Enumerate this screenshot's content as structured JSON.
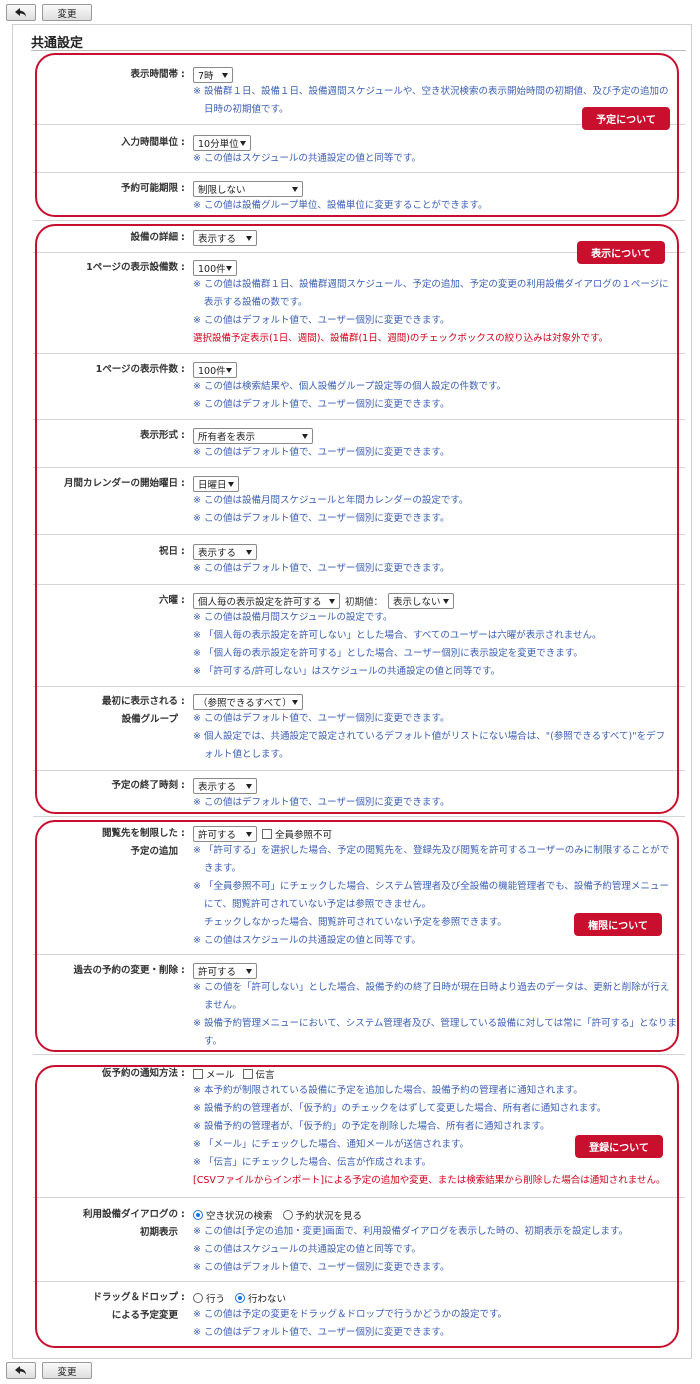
{
  "toolbar": {
    "back_label": "",
    "change_label": "変更"
  },
  "section_title": "共通設定",
  "rows": {
    "display_time_zone": {
      "label": "表示時間帯",
      "value": "7時",
      "notes": [
        "※ 設備群１日、設備１日、設備週間スケジュールや、空き状況検索の表示開始時間の初期値、及び予定の追加の",
        "日時の初期値です。"
      ]
    },
    "input_time_unit": {
      "label": "入力時間単位",
      "value": "10分単位",
      "notes": [
        "※ この値はスケジュールの共通設定の値と同等です。"
      ]
    },
    "reservation_limit": {
      "label": "予約可能期限",
      "value": "制限しない",
      "notes": [
        "※ この値は設備グループ単位、設備単位に変更することができます。"
      ]
    },
    "equipment_details": {
      "label": "設備の詳細",
      "value": "表示する"
    },
    "equipment_per_page": {
      "label": "1ページの表示設備数",
      "value": "100件",
      "notes": [
        "※ この値は設備群１日、設備群週間スケジュール、予定の追加、予定の変更の利用設備ダイアログの１ページに",
        "表示する設備の数です。",
        "※ この値はデフォルト値で、ユーザー個別に変更できます。"
      ],
      "warning": "選択設備予定表示(1日、週間)、設備群(1日、週間)のチェックボックスの絞り込みは対象外です。"
    },
    "items_per_page": {
      "label": "1ページの表示件数",
      "value": "100件",
      "notes": [
        "※ この値は検索結果や、個人設備グループ設定等の個人設定の件数です。",
        "※ この値はデフォルト値で、ユーザー個別に変更できます。"
      ]
    },
    "display_format": {
      "label": "表示形式",
      "value": "所有者を表示",
      "notes": [
        "※ この値はデフォルト値で、ユーザー個別に変更できます。"
      ]
    },
    "calendar_start_day": {
      "label": "月間カレンダーの開始曜日",
      "value": "日曜日",
      "notes": [
        "※ この値は設備月間スケジュールと年間カレンダーの設定です。",
        "※ この値はデフォルト値で、ユーザー個別に変更できます。"
      ]
    },
    "holidays": {
      "label": "祝日",
      "value": "表示する",
      "notes": [
        "※ この値はデフォルト値で、ユーザー個別に変更できます。"
      ]
    },
    "rokuyo": {
      "label": "六曜",
      "value": "個人毎の表示設定を許可する",
      "initial_label": "初期値：",
      "initial_value": "表示しない",
      "notes": [
        "※ この値は設備月間スケジュールの設定です。",
        "※ 「個人毎の表示設定を許可しない」とした場合、すべてのユーザーは六曜が表示されません。",
        "※ 「個人毎の表示設定を許可する」とした場合、ユーザー個別に表示設定を変更できます。",
        "※ 「許可する/許可しない」はスケジュールの共通設定の値と同等です。"
      ]
    },
    "first_group": {
      "label_line1": "最初に表示される",
      "label_line2": "設備グループ",
      "value": "（参照できるすべて）",
      "notes": [
        "※ この値はデフォルト値で、ユーザー個別に変更できます。",
        "※ 個人設定では、共通設定で設定されているデフォルト値がリストにない場合は、\"(参照できるすべて)\"をデフ",
        "ォルト値とします。"
      ]
    },
    "end_time": {
      "label": "予定の終了時刻",
      "value": "表示する",
      "notes": [
        "※ この値はデフォルト値で、ユーザー個別に変更できます。"
      ]
    },
    "restricted_viewers": {
      "label_line1": "閲覧先を制限した",
      "label_line2": "予定の追加",
      "value": "許可する",
      "checkbox_label": "全員参照不可",
      "notes": [
        "※ 「許可する」を選択した場合、予定の閲覧先を、登録先及び閲覧を許可するユーザーのみに制限することがで",
        "きます。",
        "※ 「全員参照不可」にチェックした場合、システム管理者及び全設備の機能管理者でも、設備予約管理メニュー",
        "にて、閲覧許可されていない予定は参照できません。",
        "チェックしなかった場合、閲覧許可されていない予定を参照できます。",
        "※ この値はスケジュールの共通設定の値と同等です。"
      ]
    },
    "past_changes": {
      "label": "過去の予約の変更・削除",
      "value": "許可する",
      "notes": [
        "※ この値を「許可しない」とした場合、設備予約の終了日時が現在日時より過去のデータは、更新と削除が行え",
        "ません。",
        "※ 設備予約管理メニューにおいて、システム管理者及び、管理している設備に対しては常に「許可する」となりま",
        "す。"
      ]
    },
    "tentative_notification": {
      "label": "仮予約の通知方法",
      "option1": "メール",
      "option2": "伝言",
      "notes": [
        "※ 本予約が制限されている設備に予定を追加した場合、設備予約の管理者に通知されます。",
        "※ 設備予約の管理者が、「仮予約」のチェックをはずして変更した場合、所有者に通知されます。",
        "※ 設備予約の管理者が、「仮予約」の予定を削除した場合、所有者に通知されます。",
        "※ 「メール」にチェックした場合、通知メールが送信されます。",
        "※ 「伝言」にチェックした場合、伝言が作成されます。"
      ],
      "warning": "[CSVファイルからインポート]による予定の追加や変更、または検索結果から削除した場合は通知されません。"
    },
    "dialog_initial": {
      "label_line1": "利用設備ダイアログの",
      "label_line2": "初期表示",
      "option1": "空き状況の検索",
      "option2": "予約状況を見る",
      "notes": [
        "※ この値は[予定の追加・変更]画面で、利用設備ダイアログを表示した時の、初期表示を設定します。",
        "※ この値はスケジュールの共通設定の値と同等です。",
        "※ この値はデフォルト値で、ユーザー個別に変更できます。"
      ]
    },
    "drag_drop": {
      "label_line1": "ドラッグ＆ドロップ",
      "label_line2": "による予定変更",
      "option1": "行う",
      "option2": "行わない",
      "notes": [
        "※ この値は予定の変更をドラッグ＆ドロップで行うかどうかの設定です。",
        "※ この値はデフォルト値で、ユーザー個別に変更できます。"
      ]
    }
  },
  "callouts": {
    "schedule": "予定について",
    "display": "表示について",
    "permission": "権限について",
    "registration": "登録について"
  },
  "colors": {
    "accent_red": "#c8102e",
    "note_blue": "#3c5fb4",
    "warning_red": "#d0021b"
  }
}
